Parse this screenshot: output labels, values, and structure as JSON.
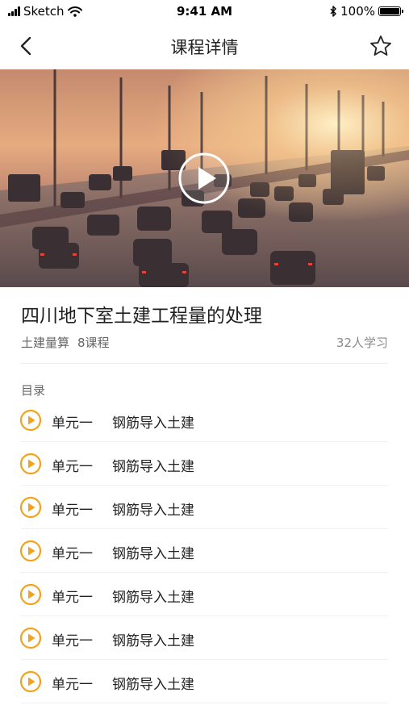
{
  "status_bar": {
    "carrier": "Sketch",
    "time": "9:41 AM",
    "battery": "100%"
  },
  "nav": {
    "title": "课程详情",
    "back_icon": "chevron-left-icon",
    "favorite_icon": "star-outline-icon"
  },
  "hero": {
    "play_icon": "play-icon"
  },
  "course": {
    "title": "四川地下室土建工程量的处理",
    "category": "土建量算",
    "lesson_count": "8课程",
    "learners": "32人学习"
  },
  "catalog": {
    "heading": "目录",
    "lessons": [
      {
        "unit": "单元一",
        "title": "钢筋导入土建"
      },
      {
        "unit": "单元一",
        "title": "钢筋导入土建"
      },
      {
        "unit": "单元一",
        "title": "钢筋导入土建"
      },
      {
        "unit": "单元一",
        "title": "钢筋导入土建"
      },
      {
        "unit": "单元一",
        "title": "钢筋导入土建"
      },
      {
        "unit": "单元一",
        "title": "钢筋导入土建"
      },
      {
        "unit": "单元一",
        "title": "钢筋导入土建"
      }
    ]
  },
  "colors": {
    "accent": "#F5A21B",
    "text_primary": "#222222",
    "text_secondary": "#666666"
  }
}
